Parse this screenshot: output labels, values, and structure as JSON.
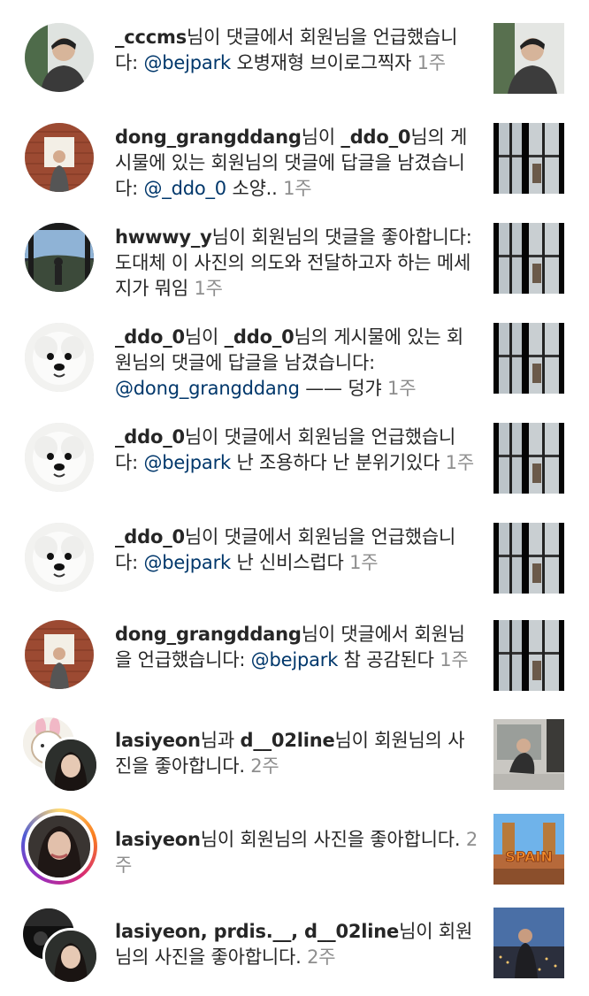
{
  "notifications": [
    {
      "segments": [
        {
          "text": "_cccms",
          "style": "user"
        },
        {
          "text": "님이 댓글에서 회원님을 언급했습니다: ",
          "style": "plain"
        },
        {
          "text": "@bejpark",
          "style": "mention"
        },
        {
          "text": " 오병재형 브이로그찍자 ",
          "style": "plain"
        },
        {
          "text": "1주",
          "style": "time"
        }
      ],
      "avatar_icon": "avatar-man-portrait",
      "thumbnail_icon": "man-portrait-thumbnail"
    },
    {
      "segments": [
        {
          "text": "dong_grangddang",
          "style": "user"
        },
        {
          "text": "님이 ",
          "style": "plain"
        },
        {
          "text": "_ddo_0",
          "style": "user"
        },
        {
          "text": "님의 게시물에 있는 회원님의 댓글에 답글을 남겼습니다: ",
          "style": "plain"
        },
        {
          "text": "@_ddo_0",
          "style": "mention"
        },
        {
          "text": " 소양.. ",
          "style": "plain"
        },
        {
          "text": "1주",
          "style": "time"
        }
      ],
      "avatar_icon": "avatar-brick-wall",
      "thumbnail_icon": "window-photo-thumbnail"
    },
    {
      "segments": [
        {
          "text": "hwwwy_y",
          "style": "user"
        },
        {
          "text": "님이 회원님의 댓글을 좋아합니다: 도대체 이 사진의 의도와 전달하고자 하는 메세지가 뭐임 ",
          "style": "plain"
        },
        {
          "text": "1주",
          "style": "time"
        }
      ],
      "avatar_icon": "avatar-landscape",
      "thumbnail_icon": "window-photo-thumbnail"
    },
    {
      "segments": [
        {
          "text": "_ddo_0",
          "style": "user"
        },
        {
          "text": "님이 ",
          "style": "plain"
        },
        {
          "text": "_ddo_0",
          "style": "user"
        },
        {
          "text": "님의 게시물에 있는 회원님의 댓글에 답글을 남겼습니다: ",
          "style": "plain"
        },
        {
          "text": "@dong_grangddang",
          "style": "mention"
        },
        {
          "text": " —— 덩갸 ",
          "style": "plain"
        },
        {
          "text": "1주",
          "style": "time"
        }
      ],
      "avatar_icon": "avatar-white-dog",
      "thumbnail_icon": "window-photo-thumbnail"
    },
    {
      "segments": [
        {
          "text": "_ddo_0",
          "style": "user"
        },
        {
          "text": "님이 댓글에서 회원님을 언급했습니다: ",
          "style": "plain"
        },
        {
          "text": "@bejpark",
          "style": "mention"
        },
        {
          "text": " 난 조용하다 난 분위기있다 ",
          "style": "plain"
        },
        {
          "text": "1주",
          "style": "time"
        }
      ],
      "avatar_icon": "avatar-white-dog",
      "thumbnail_icon": "window-photo-thumbnail"
    },
    {
      "segments": [
        {
          "text": "_ddo_0",
          "style": "user"
        },
        {
          "text": "님이 댓글에서 회원님을 언급했습니다: ",
          "style": "plain"
        },
        {
          "text": "@bejpark",
          "style": "mention"
        },
        {
          "text": " 난 신비스럽다 ",
          "style": "plain"
        },
        {
          "text": "1주",
          "style": "time"
        }
      ],
      "avatar_icon": "avatar-white-dog",
      "thumbnail_icon": "window-photo-thumbnail"
    },
    {
      "segments": [
        {
          "text": "dong_grangddang",
          "style": "user"
        },
        {
          "text": "님이 댓글에서 회원님을 언급했습니다: ",
          "style": "plain"
        },
        {
          "text": "@bejpark",
          "style": "mention"
        },
        {
          "text": " 참 공감된다 ",
          "style": "plain"
        },
        {
          "text": "1주",
          "style": "time"
        }
      ],
      "avatar_icon": "avatar-brick-wall",
      "thumbnail_icon": "window-photo-thumbnail"
    },
    {
      "segments": [
        {
          "text": "lasiyeon",
          "style": "user"
        },
        {
          "text": "님과 ",
          "style": "plain"
        },
        {
          "text": "d__02line",
          "style": "user"
        },
        {
          "text": "님이 회원님의 사진을 좋아합니다. ",
          "style": "plain"
        },
        {
          "text": "2주",
          "style": "time"
        }
      ],
      "avatar_icon": "avatar-pair-cartoon-woman",
      "thumbnail_icon": "room-photo-thumbnail"
    },
    {
      "segments": [
        {
          "text": "lasiyeon",
          "style": "user"
        },
        {
          "text": "님이 회원님의 사진을 좋아합니다. ",
          "style": "plain"
        },
        {
          "text": "2주",
          "style": "time"
        }
      ],
      "avatar_icon": "avatar-woman-story-ring",
      "thumbnail_icon": "spain-sign-thumbnail"
    },
    {
      "segments": [
        {
          "text": "lasiyeon, prdis.__, d__02line",
          "style": "user"
        },
        {
          "text": "님이 회원님의 사진을 좋아합니다. ",
          "style": "plain"
        },
        {
          "text": "2주",
          "style": "time"
        }
      ],
      "avatar_icon": "avatar-pair-dark-woman",
      "thumbnail_icon": "city-night-thumbnail"
    }
  ],
  "spain_sign_text": "SPAIN",
  "colors": {
    "text": "#262626",
    "mention": "#00376b",
    "time": "#8e8e8e",
    "background": "#ffffff"
  }
}
